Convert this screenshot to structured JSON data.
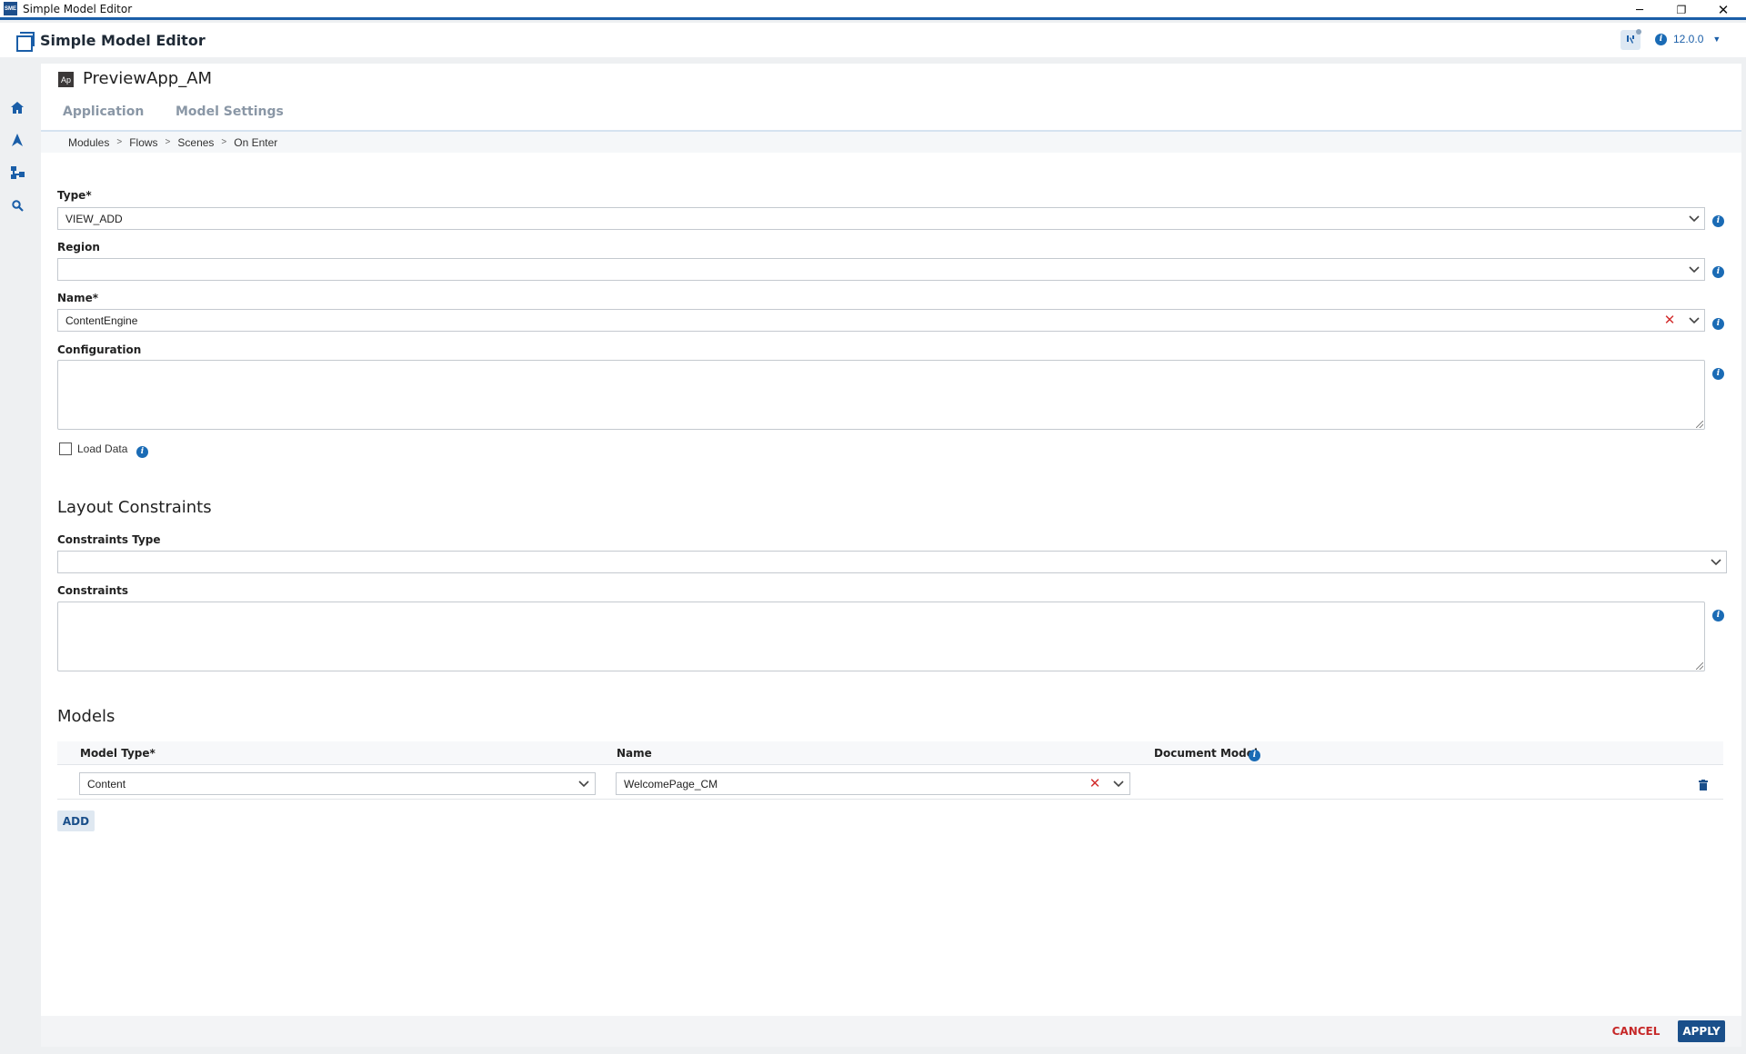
{
  "window": {
    "title": "Simple Model Editor",
    "icon_label": "SME"
  },
  "appbar": {
    "name": "Simple Model Editor",
    "version": "12.0.0"
  },
  "panel": {
    "icon_label": "Ap",
    "title": "PreviewApp_AM",
    "tabs": [
      {
        "label": "Application"
      },
      {
        "label": "Model Settings"
      }
    ]
  },
  "breadcrumb": [
    "Modules",
    "Flows",
    "Scenes",
    "On Enter"
  ],
  "form": {
    "type": {
      "label": "Type*",
      "value": "VIEW_ADD"
    },
    "region": {
      "label": "Region",
      "value": ""
    },
    "name": {
      "label": "Name*",
      "value": "ContentEngine"
    },
    "configuration": {
      "label": "Configuration",
      "value": ""
    },
    "load_data": {
      "label": "Load Data",
      "checked": false
    }
  },
  "layout_constraints": {
    "heading": "Layout Constraints",
    "constraints_type": {
      "label": "Constraints Type",
      "value": ""
    },
    "constraints": {
      "label": "Constraints",
      "value": ""
    }
  },
  "models": {
    "heading": "Models",
    "columns": [
      "Model Type*",
      "Name",
      "Document Model"
    ],
    "rows": [
      {
        "model_type": "Content",
        "name": "WelcomePage_CM",
        "document_model": ""
      }
    ],
    "add_label": "ADD"
  },
  "footer": {
    "cancel_label": "CANCEL",
    "apply_label": "APPLY"
  },
  "colors": {
    "accent": "#1a5ea8",
    "primary_button": "#1a4f8a",
    "danger": "#c62828"
  }
}
